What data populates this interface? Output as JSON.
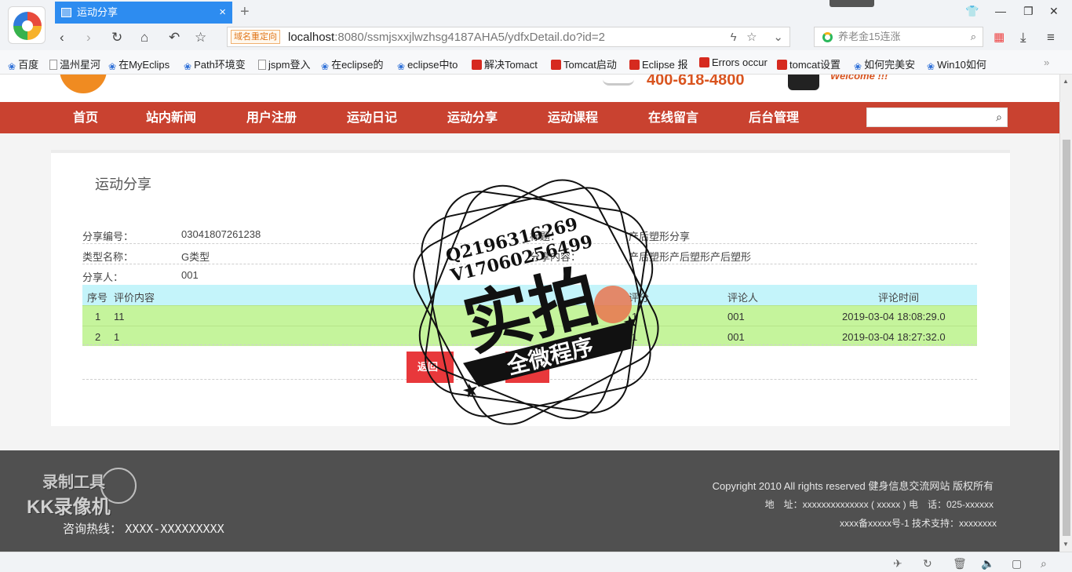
{
  "browser": {
    "tab_title": "运动分享",
    "tab_close": "×",
    "new_tab": "+",
    "redirect_tag": "域名重定向",
    "url_host": "localhost",
    "url_rest": ":8080/ssmjsxxjlwzhsg4187AHA5/ydfxDetail.do?id=2",
    "search_text": "养老金15连涨",
    "bookmarks": [
      "百度",
      "温州星河",
      "在MyEclips",
      "Path环境变",
      "jspm登入",
      "在eclipse的",
      "eclipse中to",
      "解决Tomact",
      "Tomcat启动",
      "Eclipse 报",
      "Errors occur",
      "tomcat设置",
      "如何完美安",
      "Win10如何"
    ],
    "bookmark_icons": [
      "paw-icon",
      "doc-icon",
      "paw-icon",
      "paw-icon",
      "doc-icon",
      "paw-icon",
      "paw-icon",
      "red-c-icon",
      "red-c-icon",
      "red-c-icon",
      "red-c-icon",
      "red-c-icon",
      "paw-icon",
      "paw-icon"
    ]
  },
  "header": {
    "hotline": "400-618-4800",
    "welcome": "Welcome !!!"
  },
  "nav": {
    "items": [
      "首页",
      "站内新闻",
      "用户注册",
      "运动日记",
      "运动分享",
      "运动课程",
      "在线留言",
      "后台管理"
    ]
  },
  "detail": {
    "title": "运动分享",
    "share_no_label": "分享编号：",
    "share_no": "03041807261238",
    "type_label": "类型名称：",
    "type_value": "G类型",
    "sharer_label": "分享人：",
    "sharer_value": "001",
    "title_label": "标题：",
    "title_value": "产后塑形分享",
    "content_label": "分享内容：",
    "content_value": "产后塑形产后塑形产后塑形",
    "back_button": "返回"
  },
  "comments": {
    "headers": [
      "序号",
      "评价内容",
      "评分",
      "评论人",
      "评论时间"
    ],
    "rows": [
      [
        "1",
        "11",
        "1",
        "001",
        "2019-03-04 18:08:29.0"
      ],
      [
        "2",
        "1",
        "1",
        "001",
        "2019-03-04 18:27:32.0"
      ]
    ]
  },
  "footer": {
    "copyright": "Copyright 2010 All rights reserved 健身信息交流网站 版权所有",
    "address": "地　址：xxxxxxxxxxxxxx ( xxxxx ) 电　话：025-xxxxxx",
    "icp": "xxxx备xxxxx号-1 技术支持：xxxxxxxx",
    "hotline_label": "咨询热线：",
    "hotline_value": "XXXX-XXXXXXXXX"
  },
  "watermark": {
    "line1": "Q2196316269",
    "line2": "V17060256499",
    "big": "实拍",
    "ribbon": "全微程序",
    "recorder1": "录制工具",
    "recorder2": "KK录像机"
  },
  "colors": {
    "tab_blue": "#2d8cf0",
    "nav_red": "#c94230",
    "header_cyan": "#c4f4fa",
    "row_green": "#c5f49c",
    "button_red": "#e8383b",
    "footer_gray": "#505050",
    "hotline_orange": "#d9541f"
  }
}
